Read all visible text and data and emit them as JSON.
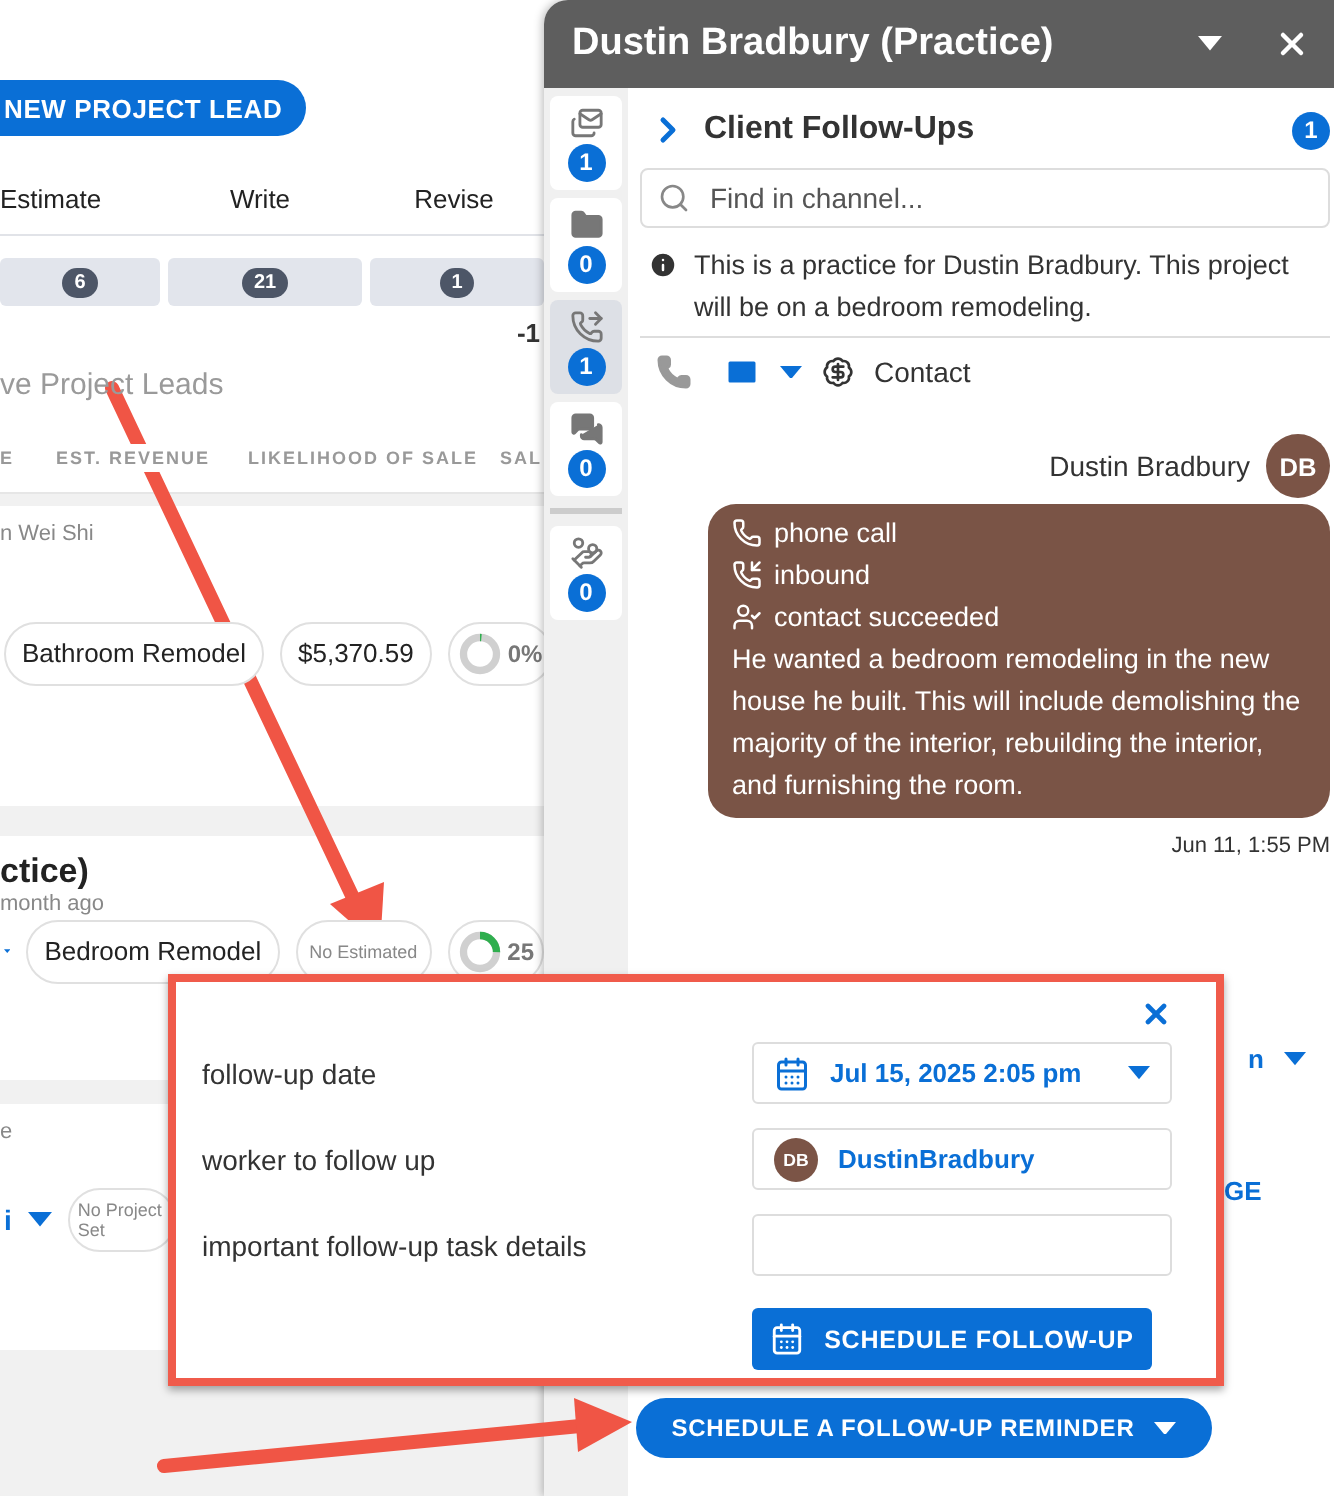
{
  "page": {
    "new_button": "NEW PROJECT LEAD",
    "stages": [
      {
        "label": "Estimate",
        "count": "6"
      },
      {
        "label": "Write",
        "count": "21"
      },
      {
        "label": "Revise",
        "count": "1"
      }
    ],
    "change": "-1",
    "section_title": "ve Project Leads",
    "columns": [
      "E",
      "EST. REVENUE",
      "LIKELIHOOD OF SALE",
      "SAL"
    ],
    "leads": [
      {
        "kind": "full",
        "subtitle": "n Wei Shi",
        "project_type": "Bathroom Remodel",
        "revenue": "$5,370.59",
        "likelihood": "0%",
        "level": 0
      },
      {
        "kind": "titled",
        "title": "ctice)",
        "subtitle": "month ago",
        "project_type": "Bedroom Remodel",
        "revenue": "No Estimated",
        "likelihood": "25",
        "level": 0.25
      },
      {
        "kind": "owner",
        "subtitle": "e",
        "owner": "i",
        "project_type": "No Project Set"
      }
    ]
  },
  "chat": {
    "title": "Dustin Bradbury (Practice)",
    "rail_groups": [
      [
        {
          "kind": "mail-stack",
          "count": "1",
          "selected": false
        },
        {
          "kind": "folder",
          "count": "0",
          "selected": false
        },
        {
          "kind": "call",
          "count": "1",
          "selected": true
        },
        {
          "kind": "chat",
          "count": "0",
          "selected": false
        }
      ],
      [
        {
          "kind": "payment",
          "count": "0",
          "selected": false
        }
      ]
    ],
    "channel_title": "Client Follow-Ups",
    "channel_badge": "1",
    "search": {
      "placeholder": "Find in channel..."
    },
    "info": "This is a practice for Dustin Bradbury. This project will be on a bedroom remodeling.",
    "composer_label": "Contact",
    "message": {
      "author": "Dustin Bradbury",
      "initials": "DB",
      "lines": [
        {
          "kind": "phone",
          "text": "phone call"
        },
        {
          "kind": "inbound",
          "text": "inbound"
        },
        {
          "kind": "contact",
          "text": "contact succeeded"
        }
      ],
      "body": "He wanted a bedroom remodeling in the new house he built. This will include demolishing the majority of the interior, rebuilding the interior, and furnishing the room.",
      "time": "Jun 11, 1:55 PM"
    },
    "hidden_fragments": [
      "n",
      "GE"
    ],
    "reminder_button": "SCHEDULE A FOLLOW-UP REMINDER"
  },
  "popup": {
    "fields": [
      {
        "kind": "date",
        "label": "follow-up date",
        "value": "Jul 15, 2025 2:05 pm"
      },
      {
        "kind": "worker",
        "label": "worker to follow up",
        "initials": "DB",
        "value": "DustinBradbury"
      },
      {
        "kind": "text",
        "label": "important follow-up task details"
      }
    ],
    "button": "SCHEDULE FOLLOW-UP"
  }
}
